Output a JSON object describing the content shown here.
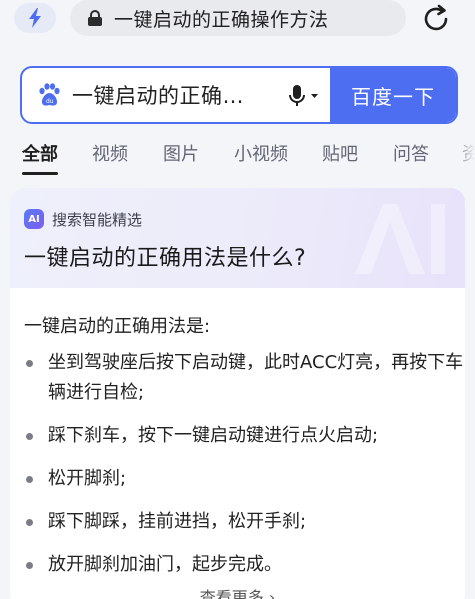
{
  "address_bar": {
    "url_text": "一键启动的正确操作方法"
  },
  "search": {
    "query": "一键启动的正确…",
    "button_label": "百度一下"
  },
  "tabs": [
    {
      "label": "全部",
      "active": true
    },
    {
      "label": "视频",
      "active": false
    },
    {
      "label": "图片",
      "active": false
    },
    {
      "label": "小视频",
      "active": false
    },
    {
      "label": "贴吧",
      "active": false
    },
    {
      "label": "问答",
      "active": false
    },
    {
      "label": "资",
      "active": false
    }
  ],
  "ai_card": {
    "badge": "AI",
    "label": "搜索智能精选",
    "question": "一键启动的正确用法是什么?",
    "answer_intro": "一键启动的正确用法是:",
    "steps": [
      "坐到驾驶座后按下启动键，此时ACC灯亮，再按下车辆进行自检;",
      "踩下刹车，按下一键启动键进行点火启动;",
      "松开脚刹;",
      "踩下脚踩，挂前进挡，松开手刹;",
      "放开脚刹加油门，起步完成。"
    ],
    "more_label": "查看更多"
  },
  "colors": {
    "accent": "#4e6ef2",
    "bolt": "#4e6ef2"
  }
}
